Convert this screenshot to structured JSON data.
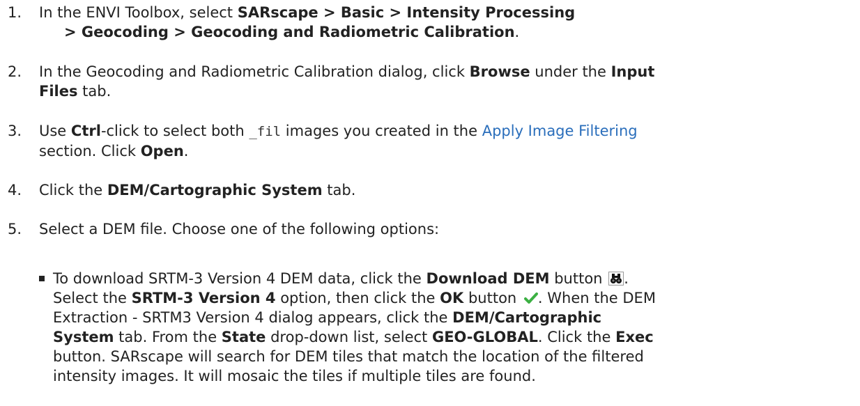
{
  "steps": [
    {
      "number": "1.",
      "t1": "In the ENVI Toolbox, select ",
      "b1": "SARscape > Basic > Intensity Processing",
      "b2": "> Geocoding > Geocoding and Radiometric Calibration",
      "t2": "."
    },
    {
      "number": "2.",
      "t1": "In the Geocoding and Radiometric Calibration dialog, click ",
      "b1": "Browse",
      "t2": " under the ",
      "b2": "Input",
      "b3": "Files",
      "t3": " tab."
    },
    {
      "number": "3.",
      "t1": "Use ",
      "b1": "Ctrl",
      "t2": "-click to select both ",
      "code": "_fil",
      "t3": " images you created in the ",
      "link": "Apply Image Filtering",
      "t4": "section. Click ",
      "b2": "Open",
      "t5": "."
    },
    {
      "number": "4.",
      "t1": "Click the ",
      "b1": "DEM/Cartographic System",
      "t2": " tab."
    },
    {
      "number": "5.",
      "t1": "Select a DEM file. Choose one of the following options:"
    }
  ],
  "bullet": {
    "l1a": "To download SRTM-3 Version 4 DEM data, click the ",
    "l1b": "Download DEM",
    "l1c": " button",
    "l1d": ".",
    "l2a": "Select the ",
    "l2b": "SRTM-3 Version 4",
    "l2c": " option, then click the ",
    "l2d": "OK",
    "l2e": " button",
    "l2f": ". When the DEM",
    "l3a": "Extraction - SRTM3 Version 4 dialog appears, click the ",
    "l3b": "DEM/Cartographic",
    "l4a": "System",
    "l4b": " tab. From the ",
    "l4c": "State",
    "l4d": " drop-down list, select ",
    "l4e": "GEO-GLOBAL",
    "l4f": ". Click the ",
    "l4g": "Exec",
    "l5": "button. SARscape will search for DEM tiles that match the location of the filtered",
    "l6": "intensity images. It will mosaic the tiles if multiple tiles are found."
  },
  "icons": {
    "download_dem": "binoculars-icon",
    "ok": "check-icon",
    "check_color": "#3cb043",
    "link_color": "#2a6ebb"
  }
}
